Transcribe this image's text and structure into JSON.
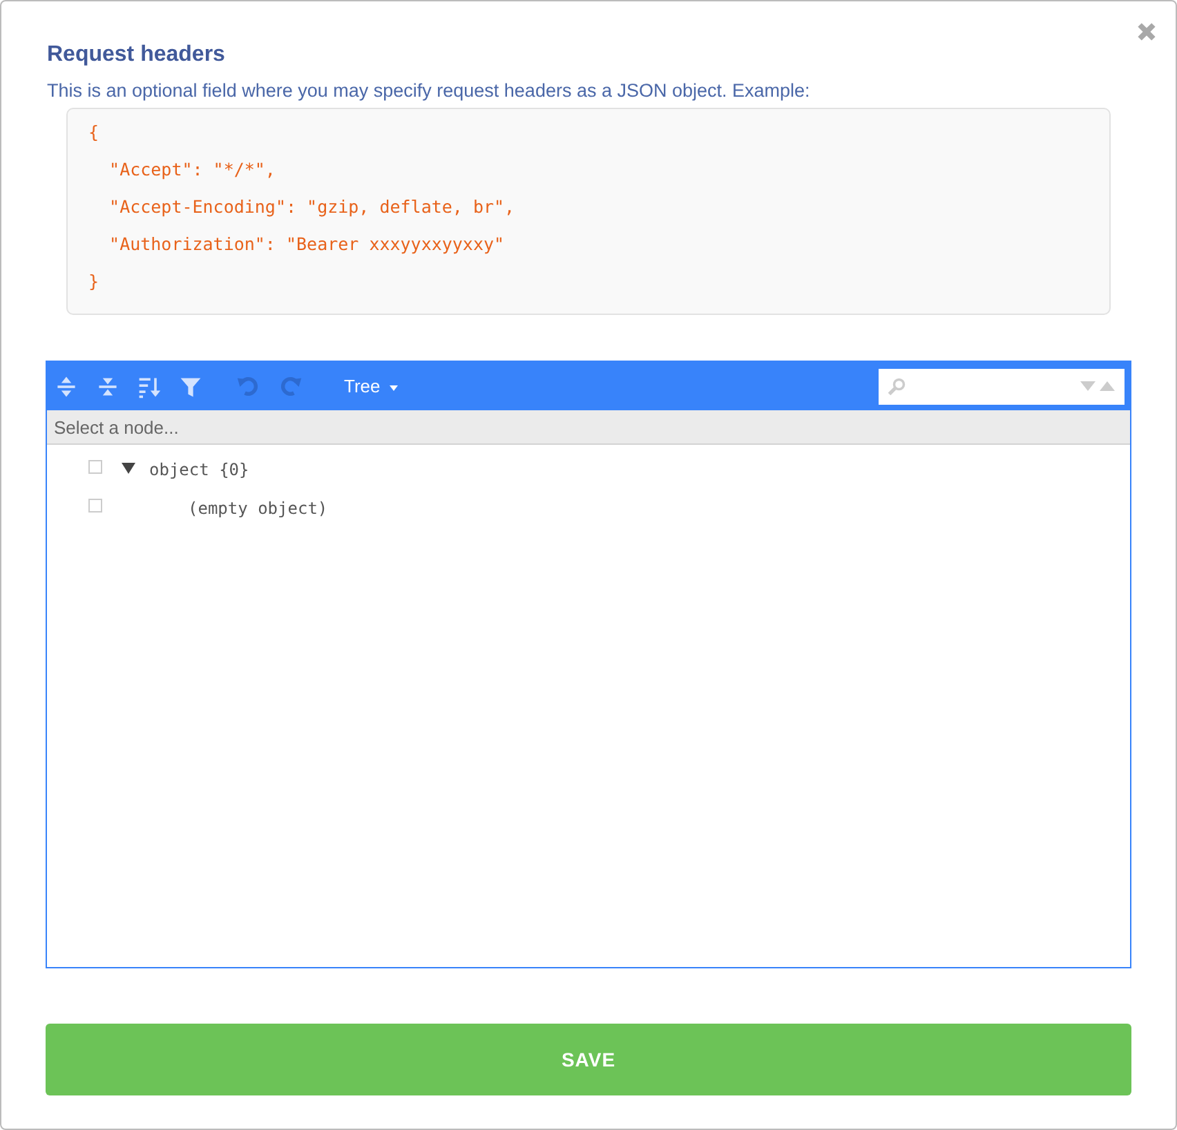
{
  "title": "Request headers",
  "description": "This is an optional field where you may specify request headers as a JSON object. Example:",
  "example_lines": [
    "{",
    "  \"Accept\": \"*/*\",",
    "  \"Accept-Encoding\": \"gzip, deflate, br\",",
    "  \"Authorization\": \"Bearer xxxyyxxyyxxy\"",
    "}"
  ],
  "editor": {
    "toolbar": [
      {
        "kind": "expand",
        "disabled": false
      },
      {
        "kind": "collapse",
        "disabled": false
      },
      {
        "kind": "sort",
        "disabled": false
      },
      {
        "kind": "filter",
        "disabled": false
      },
      {
        "kind": "undo",
        "disabled": true
      },
      {
        "kind": "redo",
        "disabled": true
      }
    ],
    "mode": "Tree",
    "navigation": "Select a node...",
    "tree": {
      "label": "object {0}",
      "expanded": true,
      "empty_text": "(empty object)"
    }
  },
  "save_button": "SAVE"
}
